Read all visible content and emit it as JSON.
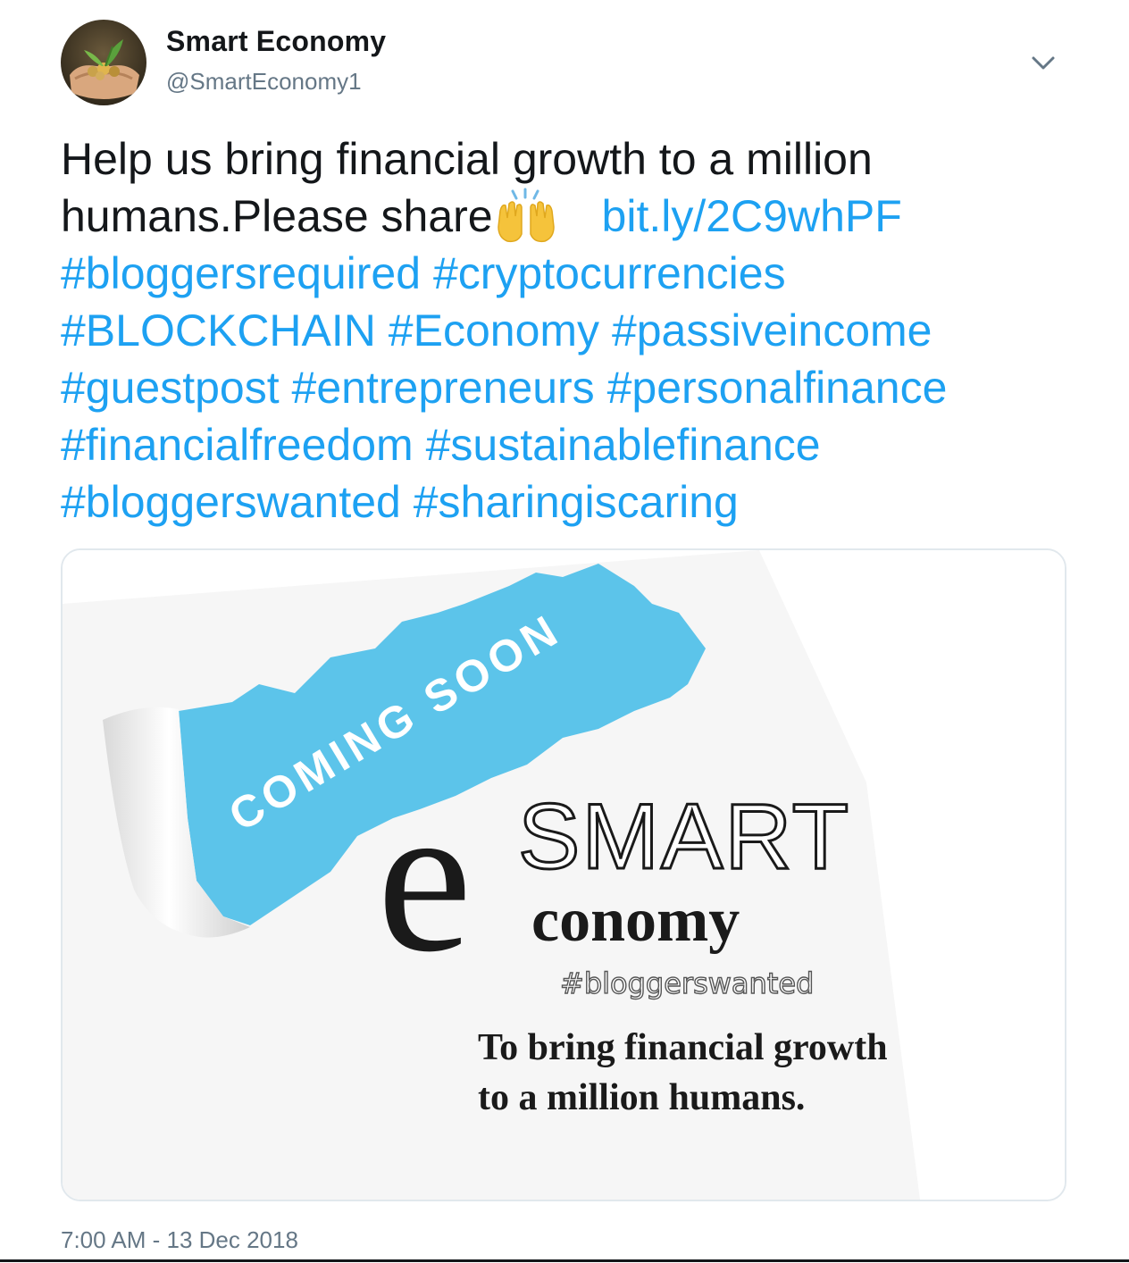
{
  "author": {
    "name": "Smart Economy",
    "handle": "@SmartEconomy1",
    "avatar_icon": "hands-holding-coins-plant-avatar"
  },
  "menu": {
    "caret_icon": "chevron-down-icon"
  },
  "tweet": {
    "text_line1": "Help us bring financial growth to a million",
    "text_line2": "humans.Please share",
    "emoji_icon": "raising-hands-emoji",
    "link": "bit.ly/2C9whPF",
    "hashtags": [
      "#bloggersrequired",
      "#cryptocurrencies",
      "#BLOCKCHAIN",
      "#Economy",
      "#passiveincome",
      "#guestpost",
      "#entrepreneurs",
      "#personalfinance",
      "#financialfreedom",
      "#sustainablefinance",
      "#bloggerswanted",
      "#sharingiscaring"
    ]
  },
  "media": {
    "banner_text": "COMING SOON",
    "logo_big_letter": "e",
    "logo_smart": "SMART",
    "logo_conomy": "conomy",
    "logo_hashtag": "#bloggerswanted",
    "tagline_line1": "To bring financial growth",
    "tagline_line2": "to a million humans."
  },
  "timestamp": "7:00 AM - 13 Dec 2018",
  "colors": {
    "link": "#1da1f2",
    "text": "#14171a",
    "muted": "#657786",
    "border": "#e1e8ed",
    "banner_blue": "#5cc4ea"
  }
}
